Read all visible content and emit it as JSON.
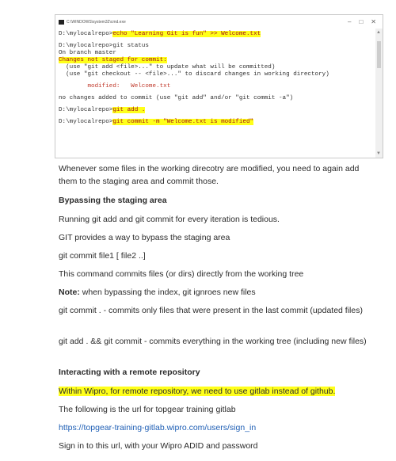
{
  "terminal": {
    "title": "C:\\WINDOWS\\system32\\cmd.exe",
    "controls": {
      "minimize": "–",
      "maximize": "□",
      "close": "✕"
    },
    "lines": {
      "l1_prompt": "D:\\mylocalrepo>",
      "l1_cmd": "echo \"Learning Git is fun\" >> Welcome.txt",
      "l2": "D:\\mylocalrepo>git status",
      "l3": "On branch master",
      "l4": "Changes not staged for commit:",
      "l5": "  (use \"git add <file>...\" to update what will be committed)",
      "l6": "  (use \"git checkout -- <file>...\" to discard changes in working directory)",
      "l7": "        modified:   Welcome.txt",
      "l8": "no changes added to commit (use \"git add\" and/or \"git commit -a\")",
      "l9_prompt": "D:\\mylocalrepo>",
      "l9_cmd": "git add .",
      "l10_prompt": "D:\\mylocalrepo>",
      "l10_cmd": "git commit -m \"Welcome.txt is modified\""
    }
  },
  "doc": {
    "p1": "Whenever some files in the working direcotry are modified, you need to again add them to the staging area and commit those.",
    "h1": "Bypassing the staging area",
    "p2": "Running git add and git commit for every iteration is tedious.",
    "p3": "GIT provides a way to bypass the staging area",
    "p4": "git commit file1 [ file2 ..]",
    "p5": "This command commits files (or dirs) directly from the working tree",
    "note_label": "Note:",
    "note_text": " when bypassing the index, git ignroes new files",
    "p6": "git commit .  - commits only files that were present in the last commit (updated files)",
    "p7": "git add . && git commit  - commits everything in the working tree (including new files)",
    "h2": "Interacting with a remote repository",
    "p8": "Within Wipro, for remote repository, we need to use gitlab instead of github.",
    "p9": "The following is the url for topgear training gitlab",
    "link": "https://topgear-training-gitlab.wipro.com/users/sign_in",
    "p10": "Sign in to this url, with your Wipro  ADID and password"
  }
}
